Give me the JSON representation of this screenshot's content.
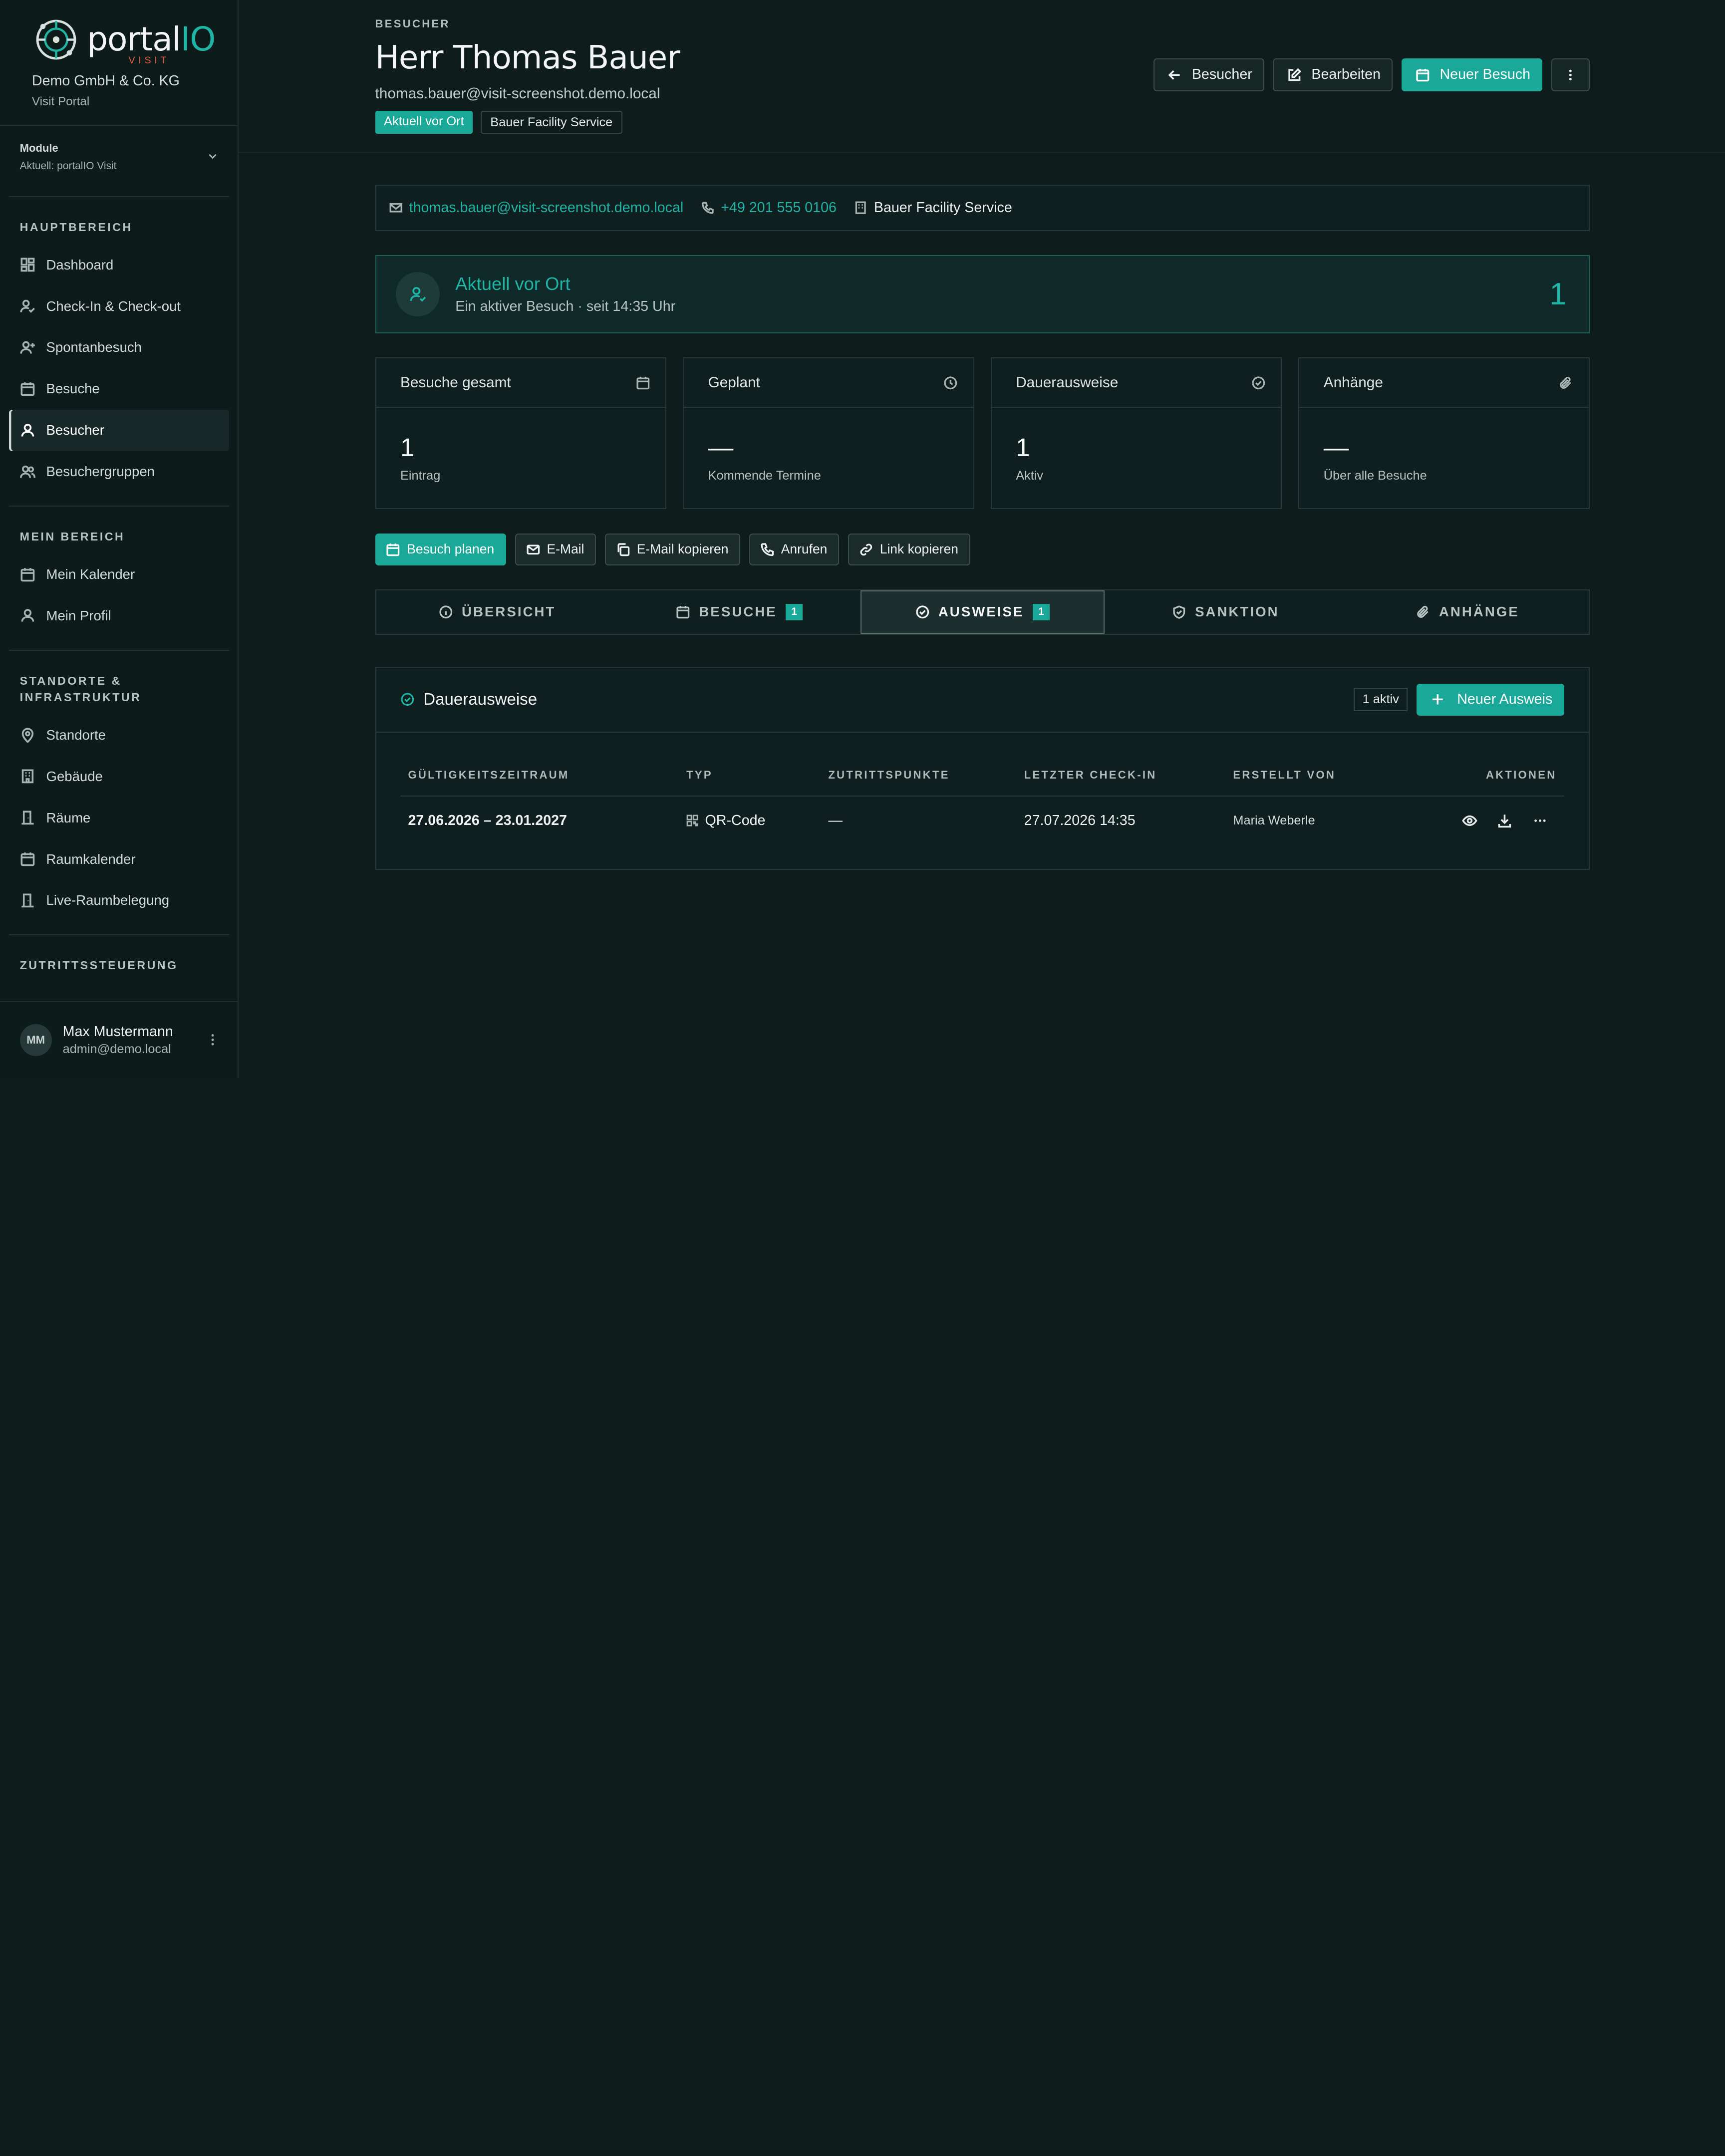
{
  "brand": {
    "logo_word_a": "portal",
    "logo_word_b": "IO",
    "logo_sub": "VISIT",
    "org_name": "Demo GmbH & Co. KG",
    "org_sub": "Visit Portal"
  },
  "module": {
    "label": "Module",
    "value": "Aktuell: portalIO Visit"
  },
  "sections": [
    {
      "title": "HAUPTBEREICH",
      "items": [
        {
          "label": "Dashboard",
          "icon": "dashboard-icon"
        },
        {
          "label": "Check-In & Check-out",
          "icon": "user-check-icon"
        },
        {
          "label": "Spontanbesuch",
          "icon": "user-plus-icon"
        },
        {
          "label": "Besuche",
          "icon": "calendar-icon"
        },
        {
          "label": "Besucher",
          "icon": "user-icon",
          "active": true
        },
        {
          "label": "Besuchergruppen",
          "icon": "users-icon"
        }
      ]
    },
    {
      "title": "MEIN BEREICH",
      "items": [
        {
          "label": "Mein Kalender",
          "icon": "calendar-icon"
        },
        {
          "label": "Mein Profil",
          "icon": "user-icon"
        }
      ]
    },
    {
      "title": "STANDORTE & INFRASTRUKTUR",
      "items": [
        {
          "label": "Standorte",
          "icon": "map-pin-icon"
        },
        {
          "label": "Gebäude",
          "icon": "building-icon"
        },
        {
          "label": "Räume",
          "icon": "door-icon"
        },
        {
          "label": "Raumkalender",
          "icon": "calendar-icon"
        },
        {
          "label": "Live-Raumbelegung",
          "icon": "door-icon"
        }
      ]
    },
    {
      "title": "ZUTRITTSSTEUERUNG",
      "items": []
    }
  ],
  "user": {
    "initials": "MM",
    "name": "Max Mustermann",
    "email": "admin@demo.local"
  },
  "header": {
    "crumb": "BESUCHER",
    "title": "Herr Thomas Bauer",
    "email": "thomas.bauer@visit-screenshot.demo.local",
    "badge_status": "Aktuell vor Ort",
    "badge_company": "Bauer Facility Service",
    "btn_back": "Besucher",
    "btn_edit": "Bearbeiten",
    "btn_new_visit": "Neuer Besuch"
  },
  "contact": {
    "email": "thomas.bauer@visit-screenshot.demo.local",
    "phone": "+49 201 555 0106",
    "company": "Bauer Facility Service"
  },
  "presence": {
    "title": "Aktuell vor Ort",
    "subtitle": "Ein aktiver Besuch · seit 14:35 Uhr",
    "count": "1"
  },
  "stats": [
    {
      "title": "Besuche gesamt",
      "value": "1",
      "label": "Eintrag",
      "icon": "calendar-icon"
    },
    {
      "title": "Geplant",
      "value": "—",
      "label": "Kommende Termine",
      "icon": "clock-icon"
    },
    {
      "title": "Dauerausweise",
      "value": "1",
      "label": "Aktiv",
      "icon": "check-circle-icon"
    },
    {
      "title": "Anhänge",
      "value": "—",
      "label": "Über alle Besuche",
      "icon": "paperclip-icon"
    }
  ],
  "quick": {
    "plan": "Besuch planen",
    "mail": "E-Mail",
    "copy_mail": "E-Mail kopieren",
    "call": "Anrufen",
    "copy_link": "Link kopieren"
  },
  "tabs": {
    "overview": "ÜBERSICHT",
    "visits": "BESUCHE",
    "visits_count": "1",
    "badges": "AUSWEISE",
    "badges_count": "1",
    "sanction": "SANKTION",
    "attachments": "ANHÄNGE"
  },
  "panel": {
    "title": "Dauerausweise",
    "chip": "1 aktiv",
    "new_btn": "Neuer Ausweis",
    "columns": {
      "validity": "GÜLTIGKEITSZEITRAUM",
      "type": "TYP",
      "access": "ZUTRITTSPUNKTE",
      "last_checkin": "LETZTER CHECK-IN",
      "created_by": "ERSTELLT VON",
      "actions": "AKTIONEN"
    },
    "row": {
      "validity": "27.06.2026 – 23.01.2027",
      "type": "QR-Code",
      "access": "—",
      "last_checkin": "27.07.2026 14:35",
      "created_by": "Maria Weberle"
    }
  }
}
